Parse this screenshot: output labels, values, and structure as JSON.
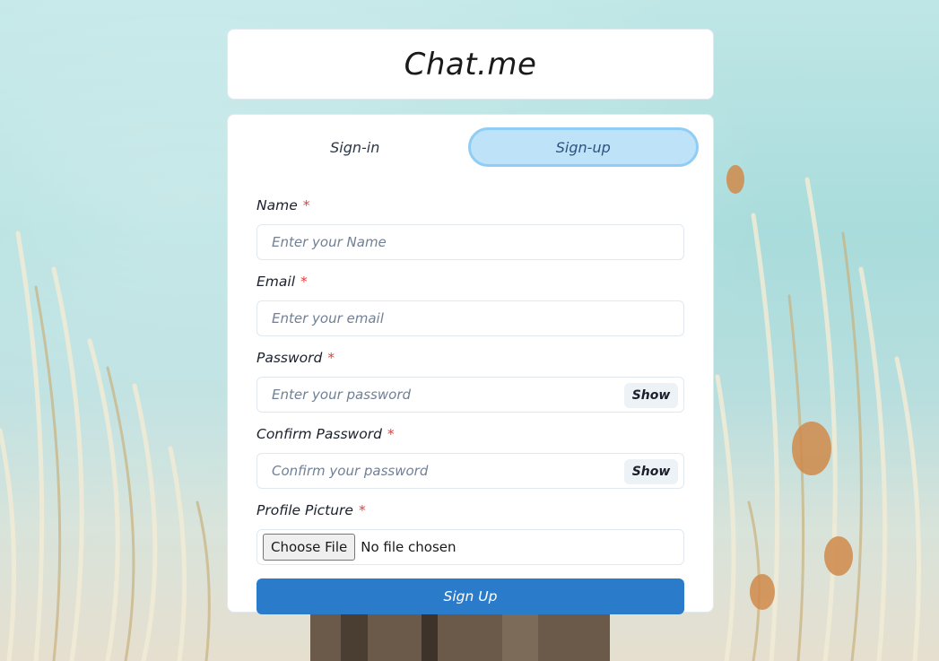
{
  "app": {
    "title": "Chat.me"
  },
  "tabs": [
    {
      "label": "Sign-in",
      "active": false
    },
    {
      "label": "Sign-up",
      "active": true
    }
  ],
  "form": {
    "name": {
      "label": "Name",
      "required_mark": "*",
      "placeholder": "Enter your Name",
      "value": ""
    },
    "email": {
      "label": "Email",
      "required_mark": "*",
      "placeholder": "Enter your email",
      "value": ""
    },
    "password": {
      "label": "Password",
      "required_mark": "*",
      "placeholder": "Enter your password",
      "value": "",
      "toggle_label": "Show"
    },
    "confirm_password": {
      "label": "Confirm Password",
      "required_mark": "*",
      "placeholder": "Confirm your password",
      "value": "",
      "toggle_label": "Show"
    },
    "profile_picture": {
      "label": "Profile Picture",
      "required_mark": "*",
      "button_label": "Choose File",
      "status": "No file chosen"
    },
    "submit_label": "Sign Up"
  },
  "colors": {
    "active_tab_bg": "#bee3f8",
    "active_tab_border": "#90cdf4",
    "submit_bg": "#2b7bcb",
    "required": "#e53e3e"
  }
}
